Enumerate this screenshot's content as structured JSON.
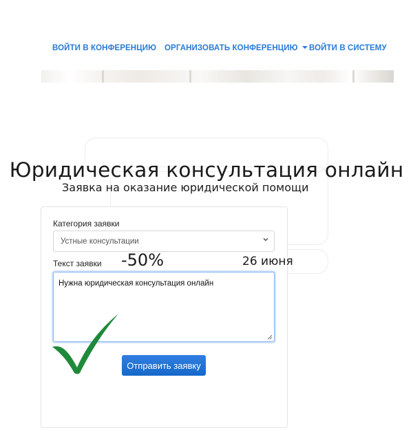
{
  "nav": {
    "items": [
      {
        "label": "ВОЙТИ В КОНФЕРЕНЦИЮ"
      },
      {
        "label": "ОРГАНИЗОВАТЬ КОНФЕРЕНЦИЮ",
        "has_dropdown": true
      },
      {
        "label": "ВОЙТИ В СИСТЕМУ"
      }
    ],
    "link_color": "#2a7ad6"
  },
  "page": {
    "title": "Юридическая консультация онлайн"
  },
  "form": {
    "heading": "Заявка на оказание юридической помощи",
    "category_label": "Категория заявки",
    "category_selected": "Устные консультации",
    "text_label": "Текст заявки",
    "text_value": "Нужна юридическая консультация онлайн",
    "submit_label": "Отправить заявку",
    "submit_color": "#1a6fd4"
  },
  "promo": {
    "discount": "-50%",
    "date": "26 июня"
  },
  "icons": {
    "select_chevron": "chevron-down-icon",
    "checkmark": "checkmark-icon",
    "resize_handle": "resize-handle-icon"
  },
  "colors": {
    "checkmark": "#1e8a3a",
    "focus_border": "#86b7f0"
  }
}
